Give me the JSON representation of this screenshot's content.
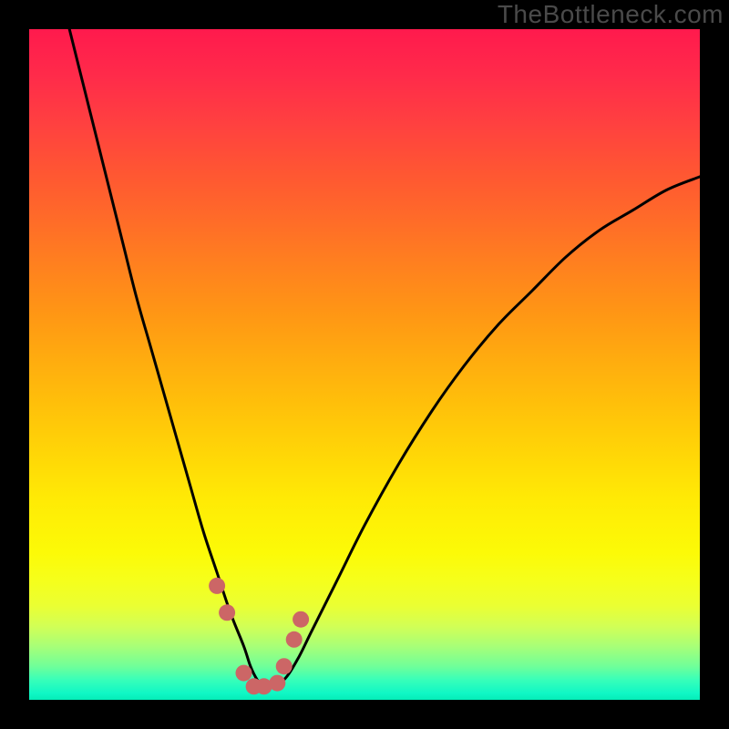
{
  "watermark": "TheBottleneck.com",
  "chart_data": {
    "type": "line",
    "title": "",
    "xlabel": "",
    "ylabel": "",
    "xlim": [
      0,
      100
    ],
    "ylim": [
      0,
      100
    ],
    "grid": false,
    "legend": false,
    "series": [
      {
        "name": "bottleneck-curve",
        "color": "#000000",
        "x": [
          6,
          8,
          10,
          12,
          14,
          16,
          18,
          20,
          22,
          24,
          26,
          28,
          30,
          32,
          33,
          34,
          35,
          36,
          38,
          40,
          42,
          46,
          50,
          55,
          60,
          65,
          70,
          75,
          80,
          85,
          90,
          95,
          100
        ],
        "y": [
          100,
          92,
          84,
          76,
          68,
          60,
          53,
          46,
          39,
          32,
          25,
          19,
          13,
          8,
          5,
          3,
          2,
          2,
          3,
          6,
          10,
          18,
          26,
          35,
          43,
          50,
          56,
          61,
          66,
          70,
          73,
          76,
          78
        ]
      },
      {
        "name": "highlight-markers",
        "color": "#cc6666",
        "type": "scatter",
        "x": [
          28,
          29.5,
          32,
          33.5,
          35,
          37,
          38,
          39.5,
          40.5
        ],
        "y": [
          17,
          13,
          4,
          2,
          2,
          2.5,
          5,
          9,
          12
        ]
      }
    ],
    "annotations": []
  }
}
